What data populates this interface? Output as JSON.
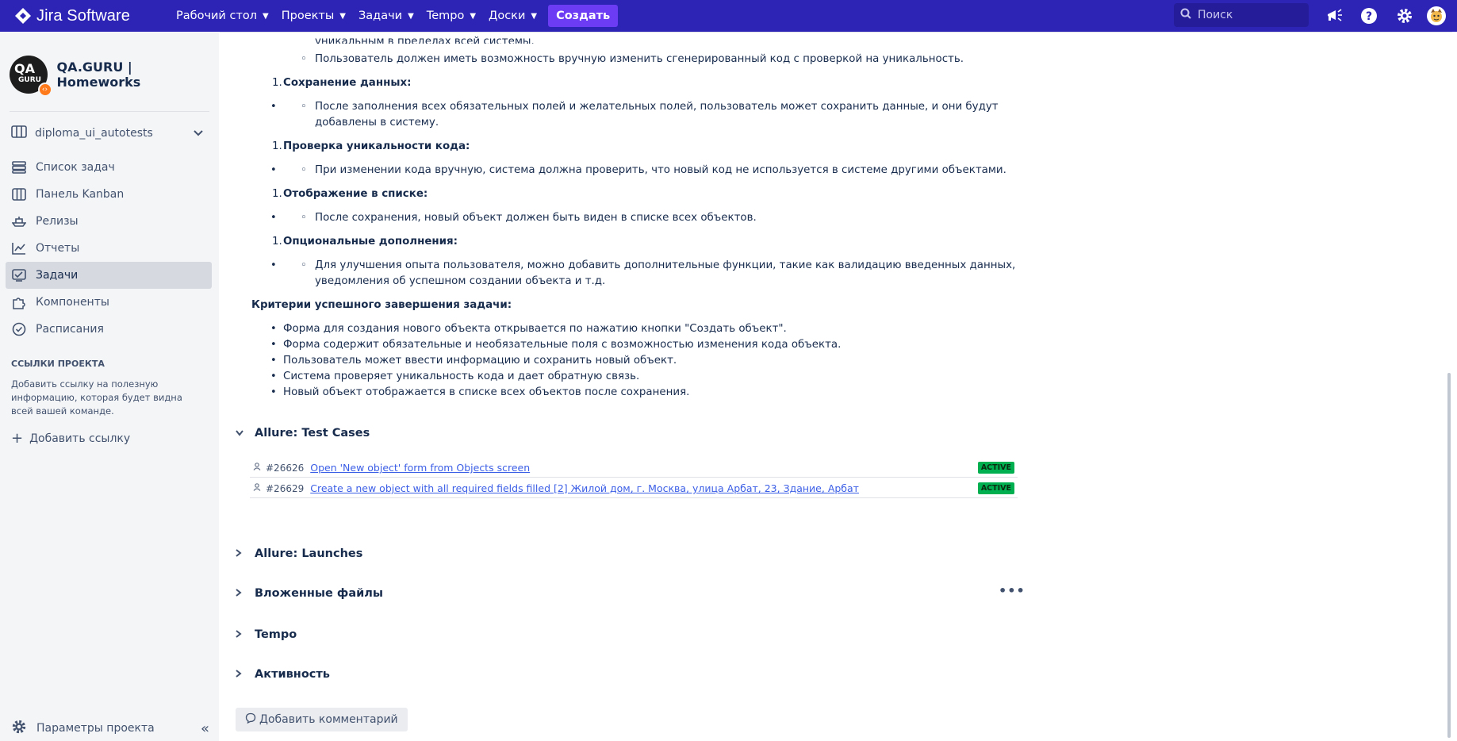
{
  "topbar": {
    "logo_text": "Jira Software",
    "nav": [
      {
        "label": "Рабочий стол"
      },
      {
        "label": "Проекты"
      },
      {
        "label": "Задачи"
      },
      {
        "label": "Tempo"
      },
      {
        "label": "Доски"
      }
    ],
    "create_label": "Создать",
    "search_placeholder": "Поиск"
  },
  "sidebar": {
    "project_name": "QA.GURU | Homeworks",
    "avatar_text_top": "QA",
    "avatar_text_bottom": "GURU",
    "board_name": "diploma_ui_autotests",
    "items": [
      {
        "label": "Список задач",
        "icon": "list-icon"
      },
      {
        "label": "Панель Kanban",
        "icon": "kanban-icon"
      },
      {
        "label": "Релизы",
        "icon": "ship-icon"
      },
      {
        "label": "Отчеты",
        "icon": "chart-icon"
      },
      {
        "label": "Задачи",
        "icon": "issues-icon",
        "active": true
      },
      {
        "label": "Компоненты",
        "icon": "puzzle-icon"
      },
      {
        "label": "Расписания",
        "icon": "clock-icon"
      }
    ],
    "links_heading": "ССЫЛКИ ПРОЕКТА",
    "links_note": "Добавить ссылку на полезную информацию, которая будет видна всей вашей команде.",
    "add_link_label": "Добавить ссылку",
    "settings_label": "Параметры проекта"
  },
  "description": {
    "cut_line": "уникальным в пределах всей системы.",
    "line_manual": "Пользователь должен иметь возможность вручную изменить сгенерированный код с проверкой на уникальность.",
    "h_save": "Сохранение данных:",
    "save_text_1": "После заполнения всех обязательных полей и желательных полей, пользователь может сохранить данные, и они будут",
    "save_text_2": "добавлены в систему.",
    "h_unique": "Проверка уникальности кода:",
    "unique_text": "При изменении кода вручную, система должна проверить, что новый код не используется в системе другими объектами.",
    "h_display": "Отображение в списке:",
    "display_text": "После сохранения, новый объект должен быть виден в списке всех объектов.",
    "h_optional": "Опциональные дополнения:",
    "optional_text_1": "Для улучшения опыта пользователя, можно добавить дополнительные функции, такие как валидацию введенных данных,",
    "optional_text_2": "уведомления об успешном создании объекта и т.д.",
    "criteria_heading": "Критерии успешного завершения задачи:",
    "criteria": [
      "Форма для создания нового объекта открывается по нажатию кнопки \"Создать объект\".",
      "Форма содержит обязательные и необязательные поля с возможностью изменения кода объекта.",
      "Пользователь может ввести информацию и сохранить новый объект.",
      "Система проверяет уникальность кода и дает обратную связь.",
      "Новый объект отображается в списке всех объектов после сохранения."
    ],
    "number_marker": "1.",
    "bullet_marker": "•",
    "circle_marker": "◦"
  },
  "sections": {
    "test_cases": "Allure: Test Cases",
    "launches": "Allure: Launches",
    "attachments": "Вложенные файлы",
    "tempo": "Tempo",
    "activity": "Активность"
  },
  "test_cases": [
    {
      "id": "#26626",
      "title": "Open 'New object' form from Objects screen",
      "status": "ACTIVE"
    },
    {
      "id": "#26629",
      "title": "Create a new object with all required fields filled [2] Жилой дом, г. Москва, улица Арбат, 23, Здание, Арбат",
      "status": "ACTIVE"
    }
  ],
  "more_label": "•••",
  "comment_button": "Добавить комментарий",
  "colors": {
    "topbar": "#2d24b5",
    "create": "#6b3cf4",
    "link": "#3b5ee6",
    "status": "#00b050"
  }
}
